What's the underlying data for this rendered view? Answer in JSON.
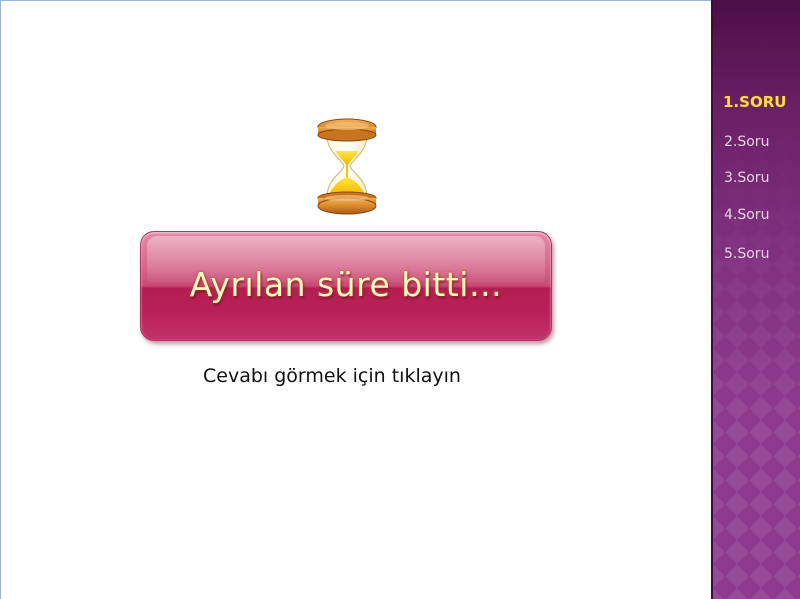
{
  "slide": {
    "banner_text": "Ayrılan süre bitti…",
    "answer_hint": "Cevabı görmek için tıklayın"
  },
  "sidebar": {
    "items": [
      {
        "label": "1.SORU",
        "active": true
      },
      {
        "label": "2.Soru",
        "active": false
      },
      {
        "label": "3.Soru",
        "active": false
      },
      {
        "label": "4.Soru",
        "active": false
      },
      {
        "label": "5.Soru",
        "active": false
      }
    ]
  },
  "icons": {
    "timer": "hourglass-icon"
  },
  "colors": {
    "banner_top": "#e58aa6",
    "banner_bottom": "#b31e52",
    "banner_text": "#fff6c8",
    "sidebar_top": "#4c0f47",
    "sidebar_bottom": "#8e3b8f",
    "active_item": "#ffd75a",
    "inactive_item": "#e7d2e8"
  }
}
